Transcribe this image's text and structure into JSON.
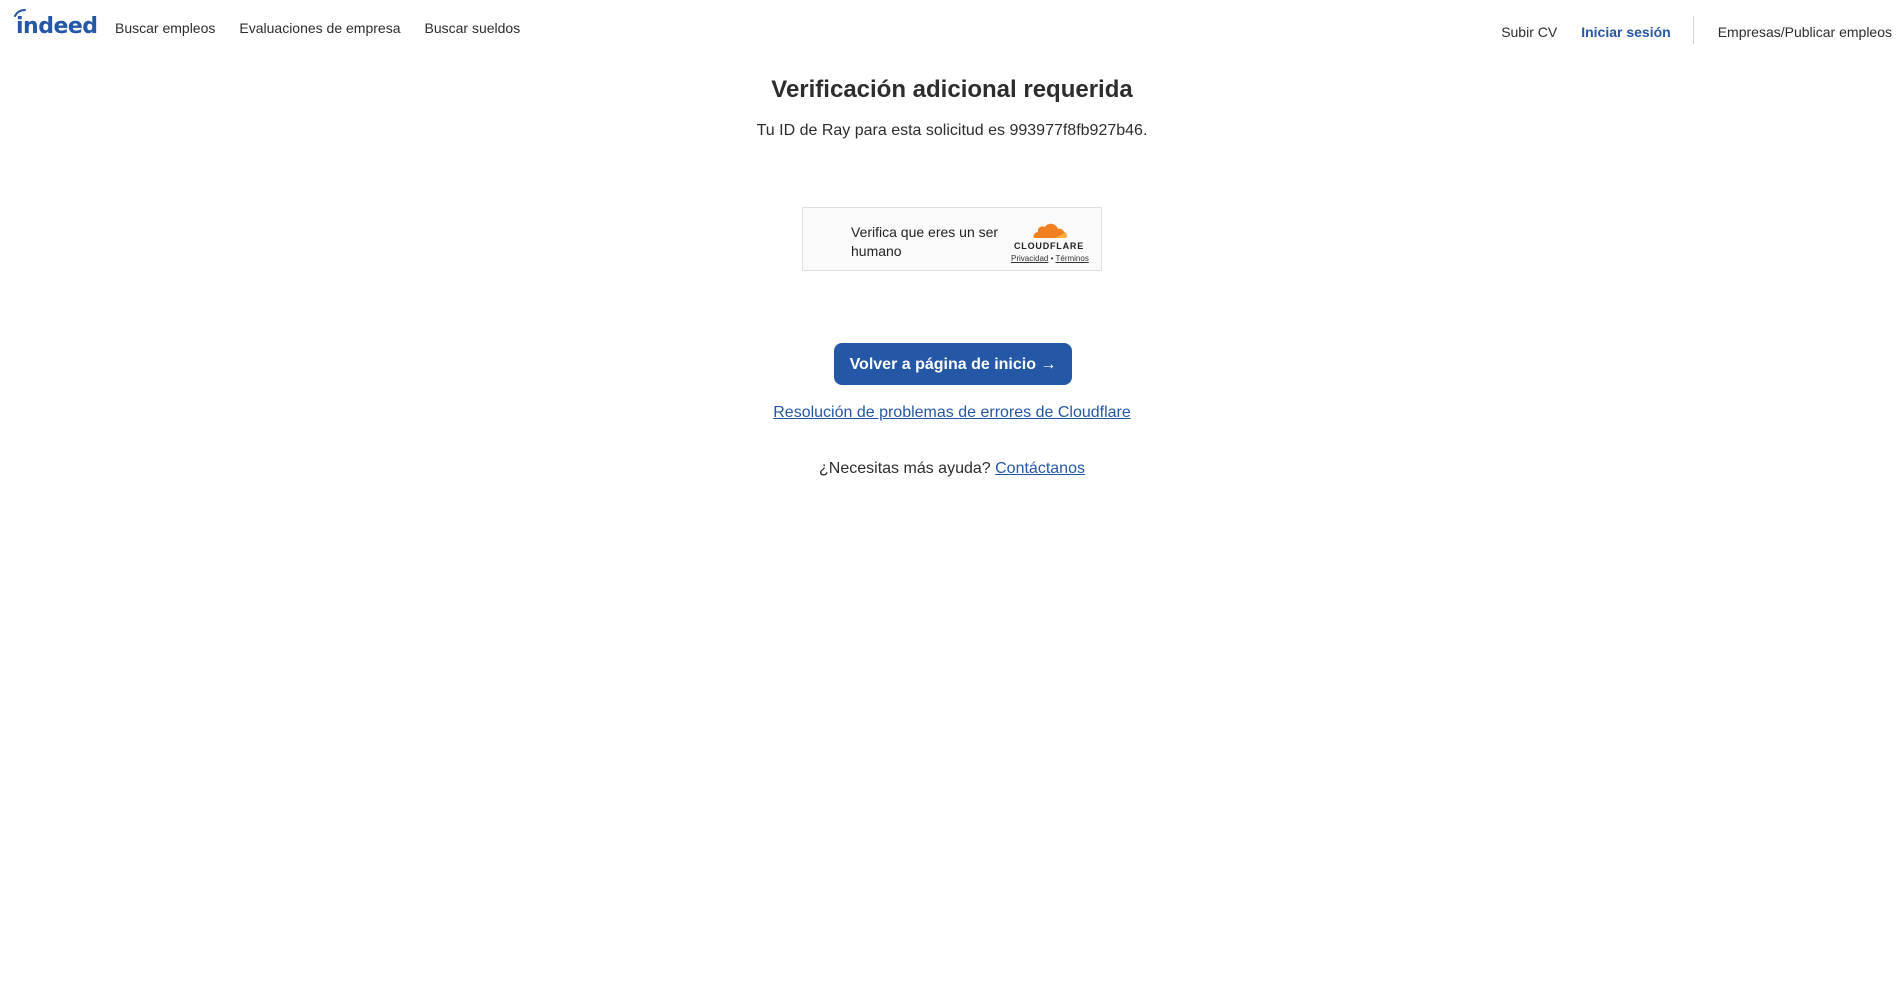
{
  "header": {
    "logo_text": "indeed",
    "nav_left": [
      {
        "label": "Buscar empleos"
      },
      {
        "label": "Evaluaciones de empresa"
      },
      {
        "label": "Buscar sueldos"
      }
    ],
    "upload_cv": "Subir CV",
    "sign_in": "Iniciar sesión",
    "employers": "Empresas/Publicar empleos"
  },
  "main": {
    "title": "Verificación adicional requerida",
    "ray_id_text": "Tu ID de Ray para esta solicitud es 993977f8fb927b46.",
    "captcha": {
      "label": "Verifica que eres un ser humano",
      "brand": "CLOUDFLARE",
      "privacy": "Privacidad",
      "separator": "•",
      "terms": "Términos"
    },
    "home_button": "Volver a página de inicio →",
    "troubleshoot_link": "Resolución de problemas de errores de Cloudflare",
    "help_prefix": "¿Necesitas más ayuda?",
    "contact_link": "Contáctanos"
  },
  "colors": {
    "brand_blue": "#2557a7",
    "cloudflare_orange": "#f38020"
  }
}
